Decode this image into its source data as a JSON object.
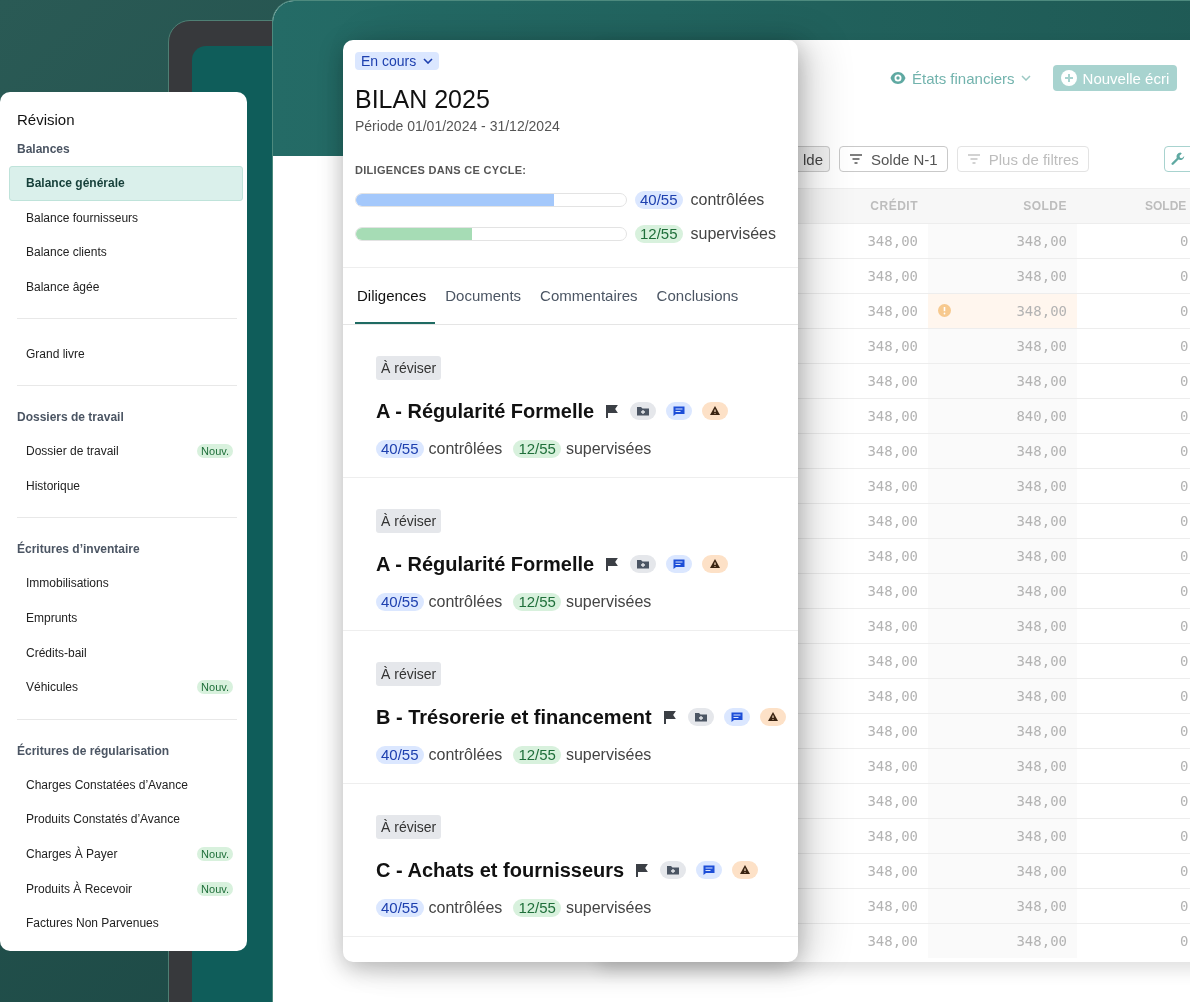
{
  "sidebar": {
    "title": "Révision",
    "sections": [
      {
        "heading": "Balances",
        "items": [
          {
            "label": "Balance générale",
            "selected": true
          },
          {
            "label": "Balance fournisseurs",
            "selected": false
          },
          {
            "label": "Balance clients",
            "selected": false
          },
          {
            "label": "Balance âgée",
            "selected": false
          }
        ]
      },
      {
        "items": [
          {
            "label": "Grand livre",
            "selected": false
          }
        ]
      },
      {
        "heading": "Dossiers de travail",
        "items": [
          {
            "label": "Dossier de travail",
            "selected": false,
            "badge": "Nouv."
          },
          {
            "label": "Historique",
            "selected": false
          }
        ]
      },
      {
        "heading": "Écritures d’inventaire",
        "items": [
          {
            "label": "Immobilisations",
            "selected": false
          },
          {
            "label": "Emprunts",
            "selected": false
          },
          {
            "label": "Crédits-bail",
            "selected": false
          },
          {
            "label": "Véhicules",
            "selected": false,
            "badge": "Nouv."
          }
        ]
      },
      {
        "heading": "Écritures de régularisation",
        "items": [
          {
            "label": "Charges Constatées d’Avance",
            "selected": false
          },
          {
            "label": "Produits Constatés d’Avance",
            "selected": false
          },
          {
            "label": "Charges À Payer",
            "selected": false,
            "badge": "Nouv."
          },
          {
            "label": "Produits À Recevoir",
            "selected": false,
            "badge": "Nouv."
          },
          {
            "label": "Factures Non Parvenues",
            "selected": false
          }
        ]
      }
    ]
  },
  "cycle_panel": {
    "status": "En cours",
    "title": "BILAN 2025",
    "period": "Période 01/01/2024 - 31/12/2024",
    "progress_heading": "DILIGENCES DANS CE CYCLE:",
    "progress": [
      {
        "kind": "controlled",
        "level": 0.735,
        "count": "40/55",
        "label": "contrôlées"
      },
      {
        "kind": "supervised",
        "level": 0.43,
        "count": "12/55",
        "label": "supervisées"
      }
    ],
    "tabs": [
      {
        "label": "Diligences",
        "selected": true
      },
      {
        "label": "Documents",
        "selected": false
      },
      {
        "label": "Commentaires",
        "selected": false
      },
      {
        "label": "Conclusions",
        "selected": false
      }
    ],
    "cycles": [
      {
        "status": "À réviser",
        "title": "A - Régularité Formelle",
        "controlled": {
          "count": "40/55",
          "label": "contrôlées"
        },
        "supervised": {
          "count": "12/55",
          "label": "supervisées"
        }
      },
      {
        "status": "À réviser",
        "title": "A - Régularité Formelle",
        "controlled": {
          "count": "40/55",
          "label": "contrôlées"
        },
        "supervised": {
          "count": "12/55",
          "label": "supervisées"
        }
      },
      {
        "status": "À réviser",
        "title": "B - Trésorerie et financement",
        "controlled": {
          "count": "40/55",
          "label": "contrôlées"
        },
        "supervised": {
          "count": "12/55",
          "label": "supervisées"
        }
      },
      {
        "status": "À réviser",
        "title": "C - Achats et fournisseurs",
        "controlled": {
          "count": "40/55",
          "label": "contrôlées"
        },
        "supervised": {
          "count": "12/55",
          "label": "supervisées"
        }
      }
    ]
  },
  "table_window": {
    "view_menu": "États financiers",
    "new_button": "Nouvelle écri",
    "filters": [
      {
        "label": "lde",
        "kind": "plain"
      },
      {
        "label": "Solde N-1",
        "kind": "filter"
      },
      {
        "label": "Plus de filtres",
        "kind": "more"
      }
    ],
    "columns": [
      "CRÉDIT",
      "SOLDE",
      "SOLDE"
    ],
    "rows": [
      {
        "cells": [
          "348,00",
          "348,00",
          "0"
        ],
        "warning": false
      },
      {
        "cells": [
          "348,00",
          "348,00",
          "0"
        ],
        "warning": false
      },
      {
        "cells": [
          "348,00",
          "348,00",
          "0"
        ],
        "warning": true
      },
      {
        "cells": [
          "348,00",
          "348,00",
          "0"
        ],
        "warning": false
      },
      {
        "cells": [
          "348,00",
          "348,00",
          "0"
        ],
        "warning": false
      },
      {
        "cells": [
          "348,00",
          "840,00",
          "0"
        ],
        "warning": false
      },
      {
        "cells": [
          "348,00",
          "348,00",
          "0"
        ],
        "warning": false
      },
      {
        "cells": [
          "348,00",
          "348,00",
          "0"
        ],
        "warning": false
      },
      {
        "cells": [
          "348,00",
          "348,00",
          "0"
        ],
        "warning": false
      },
      {
        "cells": [
          "348,00",
          "348,00",
          "0"
        ],
        "warning": false
      },
      {
        "cells": [
          "348,00",
          "348,00",
          "0"
        ],
        "warning": false
      },
      {
        "cells": [
          "348,00",
          "348,00",
          "0"
        ],
        "warning": false
      },
      {
        "cells": [
          "348,00",
          "348,00",
          "0"
        ],
        "warning": false
      },
      {
        "cells": [
          "348,00",
          "348,00",
          "0"
        ],
        "warning": false
      },
      {
        "cells": [
          "348,00",
          "348,00",
          "0"
        ],
        "warning": false
      },
      {
        "cells": [
          "348,00",
          "348,00",
          "0"
        ],
        "warning": false
      },
      {
        "cells": [
          "348,00",
          "348,00",
          "0"
        ],
        "warning": false
      },
      {
        "cells": [
          "348,00",
          "348,00",
          "0"
        ],
        "warning": false
      },
      {
        "cells": [
          "348,00",
          "348,00",
          "0"
        ],
        "warning": false
      },
      {
        "cells": [
          "348,00",
          "348,00",
          "0"
        ],
        "warning": false
      },
      {
        "cells": [
          "348,00",
          "348,00",
          "0"
        ],
        "warning": false
      }
    ]
  }
}
